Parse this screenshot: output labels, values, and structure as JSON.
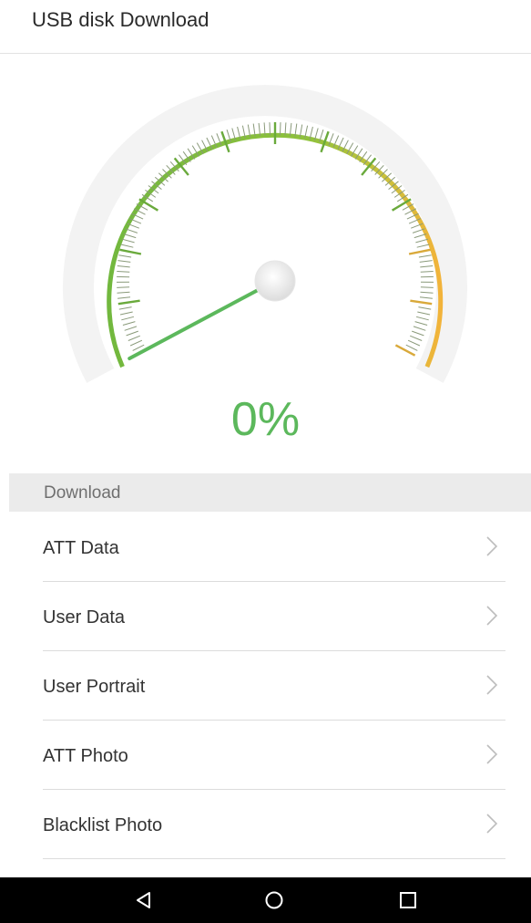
{
  "header": {
    "title": "USB disk Download"
  },
  "gauge": {
    "percent_label": "0%",
    "value_percent": 0,
    "colors": {
      "track_start": "#7bbf43",
      "track_end": "#f2b33a",
      "needle": "#5cb85c",
      "text": "#5cb85c"
    }
  },
  "section": {
    "label": "Download"
  },
  "menu": {
    "items": [
      {
        "label": "ATT Data"
      },
      {
        "label": "User Data"
      },
      {
        "label": "User Portrait"
      },
      {
        "label": "ATT Photo"
      },
      {
        "label": "Blacklist Photo"
      }
    ],
    "chevron_icon": "chevron-right-icon"
  },
  "navbar": {
    "icons": [
      "back-triangle-icon",
      "home-circle-icon",
      "recents-square-icon"
    ]
  }
}
